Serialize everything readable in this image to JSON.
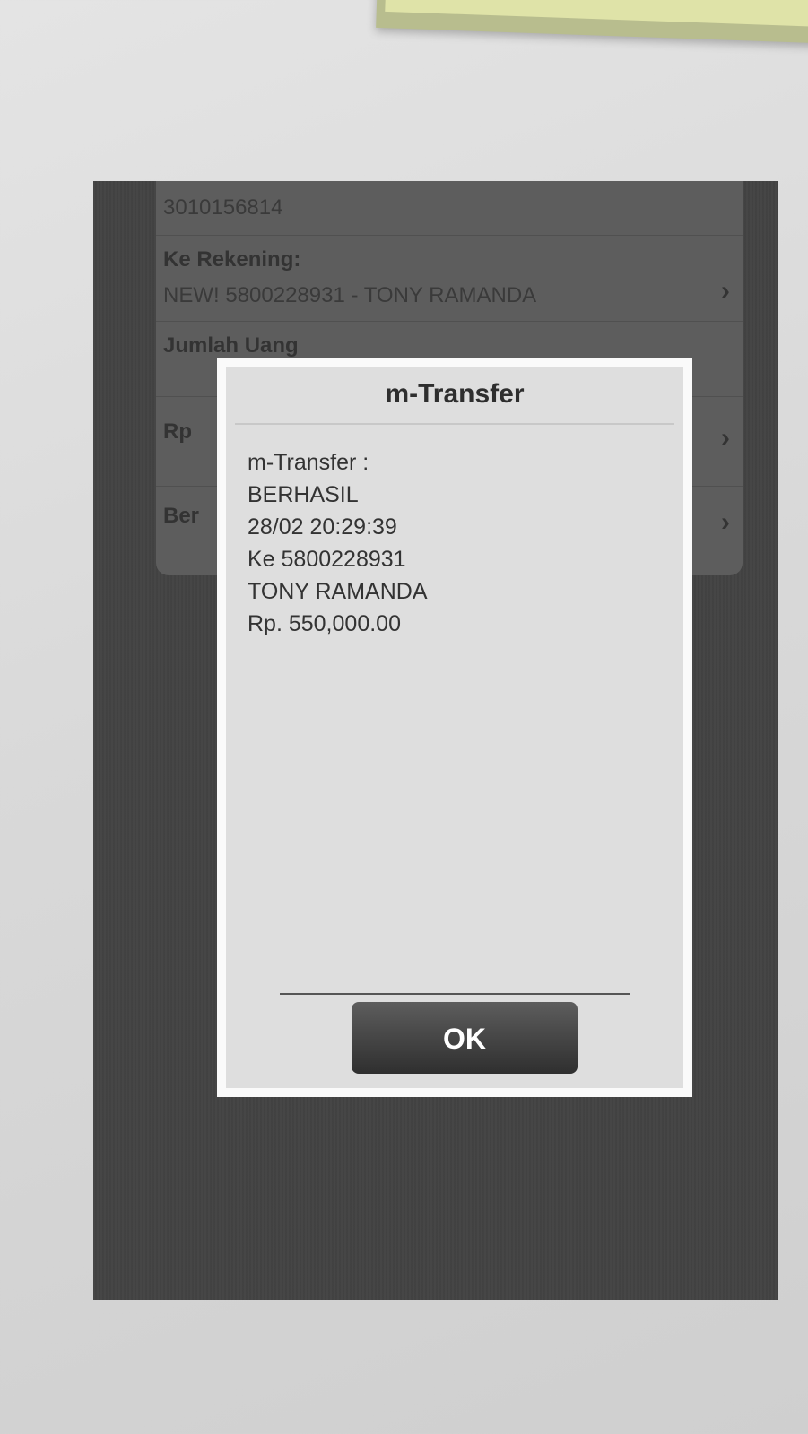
{
  "background_form": {
    "from_account_value": "3010156814",
    "to_account_label": "Ke Rekening:",
    "to_account_value": "NEW! 5800228931 - TONY RAMANDA",
    "amount_label": "Jumlah Uang",
    "amount_prefix": "Rp",
    "note_label_partial": "Ber",
    "chevron": "›"
  },
  "dialog": {
    "title": "m-Transfer",
    "lines": [
      "m-Transfer :",
      "BERHASIL",
      "28/02 20:29:39",
      "Ke 5800228931",
      "TONY RAMANDA",
      "Rp. 550,000.00"
    ],
    "ok_label": "OK"
  }
}
